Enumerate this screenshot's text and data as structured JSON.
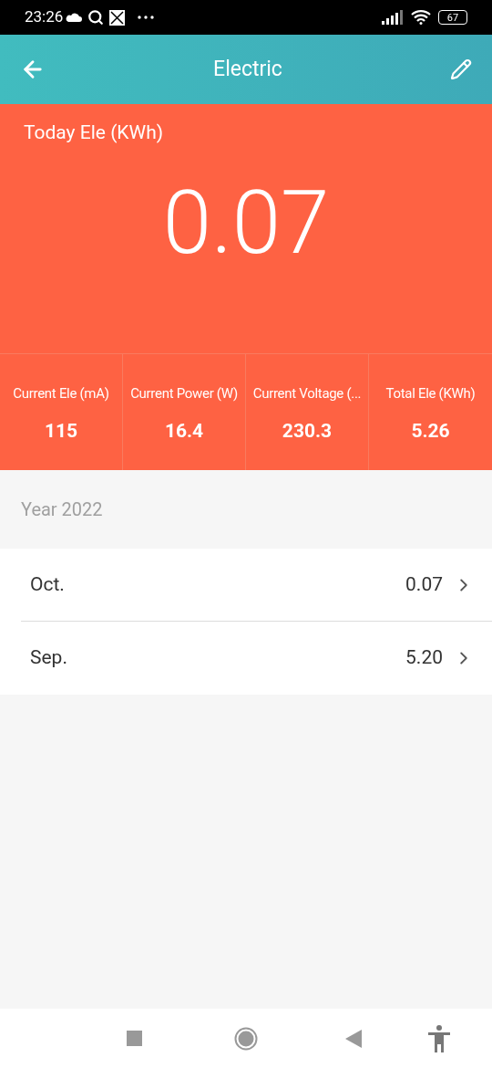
{
  "status_bar": {
    "time": "23:26",
    "battery": "67"
  },
  "header": {
    "title": "Electric"
  },
  "today": {
    "label": "Today Ele (KWh)",
    "value": "0.07"
  },
  "stats": [
    {
      "label": "Current Ele (mA)",
      "value": "115"
    },
    {
      "label": "Current Power (W)",
      "value": "16.4"
    },
    {
      "label": "Current Voltage (...",
      "value": "230.3"
    },
    {
      "label": "Total Ele (KWh)",
      "value": "5.26"
    }
  ],
  "year": {
    "label": "Year 2022"
  },
  "months": [
    {
      "name": "Oct.",
      "value": "0.07"
    },
    {
      "name": "Sep.",
      "value": "5.20"
    }
  ]
}
